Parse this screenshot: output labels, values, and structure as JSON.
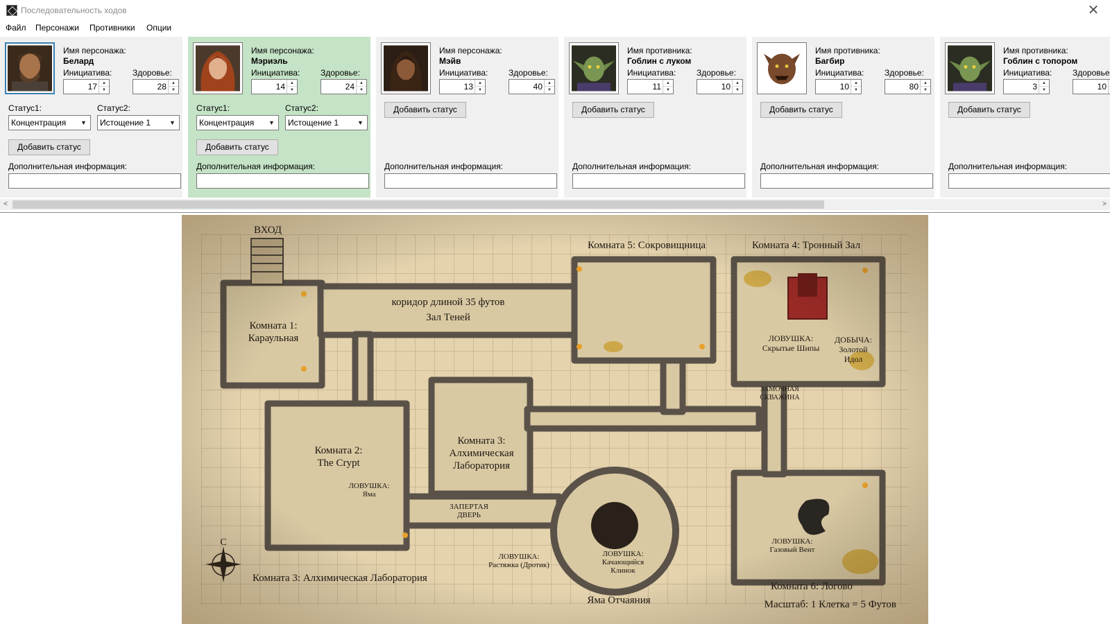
{
  "window": {
    "title": "Последовательность ходов",
    "close_icon": "close-icon"
  },
  "menu": [
    "Файл",
    "Персонажи",
    "Противники",
    "Опции"
  ],
  "labels": {
    "character_name": "Имя персонажа:",
    "enemy_name": "Имя противника:",
    "initiative": "Инициатива:",
    "health": "Здоровье:",
    "status1": "Статус1:",
    "status2": "Статус2:",
    "add_status": "Добавить статус",
    "extra_info": "Дополнительная информация:"
  },
  "cards": [
    {
      "name": "Белард",
      "initiative": "17",
      "health": "28",
      "status1": "Концентрация",
      "status2": "Истощение 1",
      "portrait": "bearded-man-portrait"
    },
    {
      "name": "Мэриэль",
      "initiative": "14",
      "health": "24",
      "status1": "Концентрация",
      "status2": "Истощение 1",
      "portrait": "red-haired-woman-portrait",
      "active": true
    },
    {
      "name": "Мэйв",
      "initiative": "13",
      "health": "40",
      "portrait": "dark-haired-woman-portrait"
    },
    {
      "name": "Гоблин с луком",
      "initiative": "11",
      "health": "10",
      "portrait": "goblin-portrait"
    },
    {
      "name": "Багбир",
      "initiative": "10",
      "health": "80",
      "portrait": "bugbear-portrait"
    },
    {
      "name": "Гоблин с топором",
      "initiative": "3",
      "health": "10",
      "portrait": "goblin-portrait"
    }
  ],
  "map": {
    "entrance": "ВХОД",
    "room1": [
      "Комната 1:",
      "Караульная"
    ],
    "corridor": [
      "коридор длиной 35 футов",
      "Зал Теней"
    ],
    "room5": "Комната 5: Сокровищница",
    "room4": "Комната 4: Тронный Зал",
    "trap_spikes": [
      "ЛОВУШКА:",
      "Скрытые Шипы"
    ],
    "loot": [
      "ДОБЫЧА:",
      "Золотой",
      "Идол"
    ],
    "keyhole": [
      "ЗАМОЧНАЯ",
      "СКВАЖИНА"
    ],
    "room2": [
      "Комната 2:",
      "The Crypt"
    ],
    "trap_pit": [
      "ЛОВУШКА:",
      "Яма"
    ],
    "room3": [
      "Комната 3:",
      "Алхимическая",
      "Лаборатория"
    ],
    "locked_door": [
      "ЗАПЕРТАЯ",
      "ДВЕРЬ"
    ],
    "trap_tripwire": [
      "ЛОВУШКА:",
      "Растяжка (Дротик)"
    ],
    "trap_blade": [
      "ЛОВУШКА:",
      "Качающийся",
      "Клинок"
    ],
    "pit_name": "Яма Отчаяния",
    "trap_gas": [
      "ЛОВУШКА:",
      "Газовый Вент"
    ],
    "room6": "Комната 6: Логово",
    "bottom_label": "Комната 3: Алхимическая Лаборатория",
    "scale": "Масштаб: 1 Клетка = 5 Футов",
    "compass": "С"
  },
  "colors": {
    "active_card": "#c5e3c6",
    "panel": "#f0f0f0",
    "parchment": "#e8d8b6",
    "stone": "#5a5248"
  }
}
